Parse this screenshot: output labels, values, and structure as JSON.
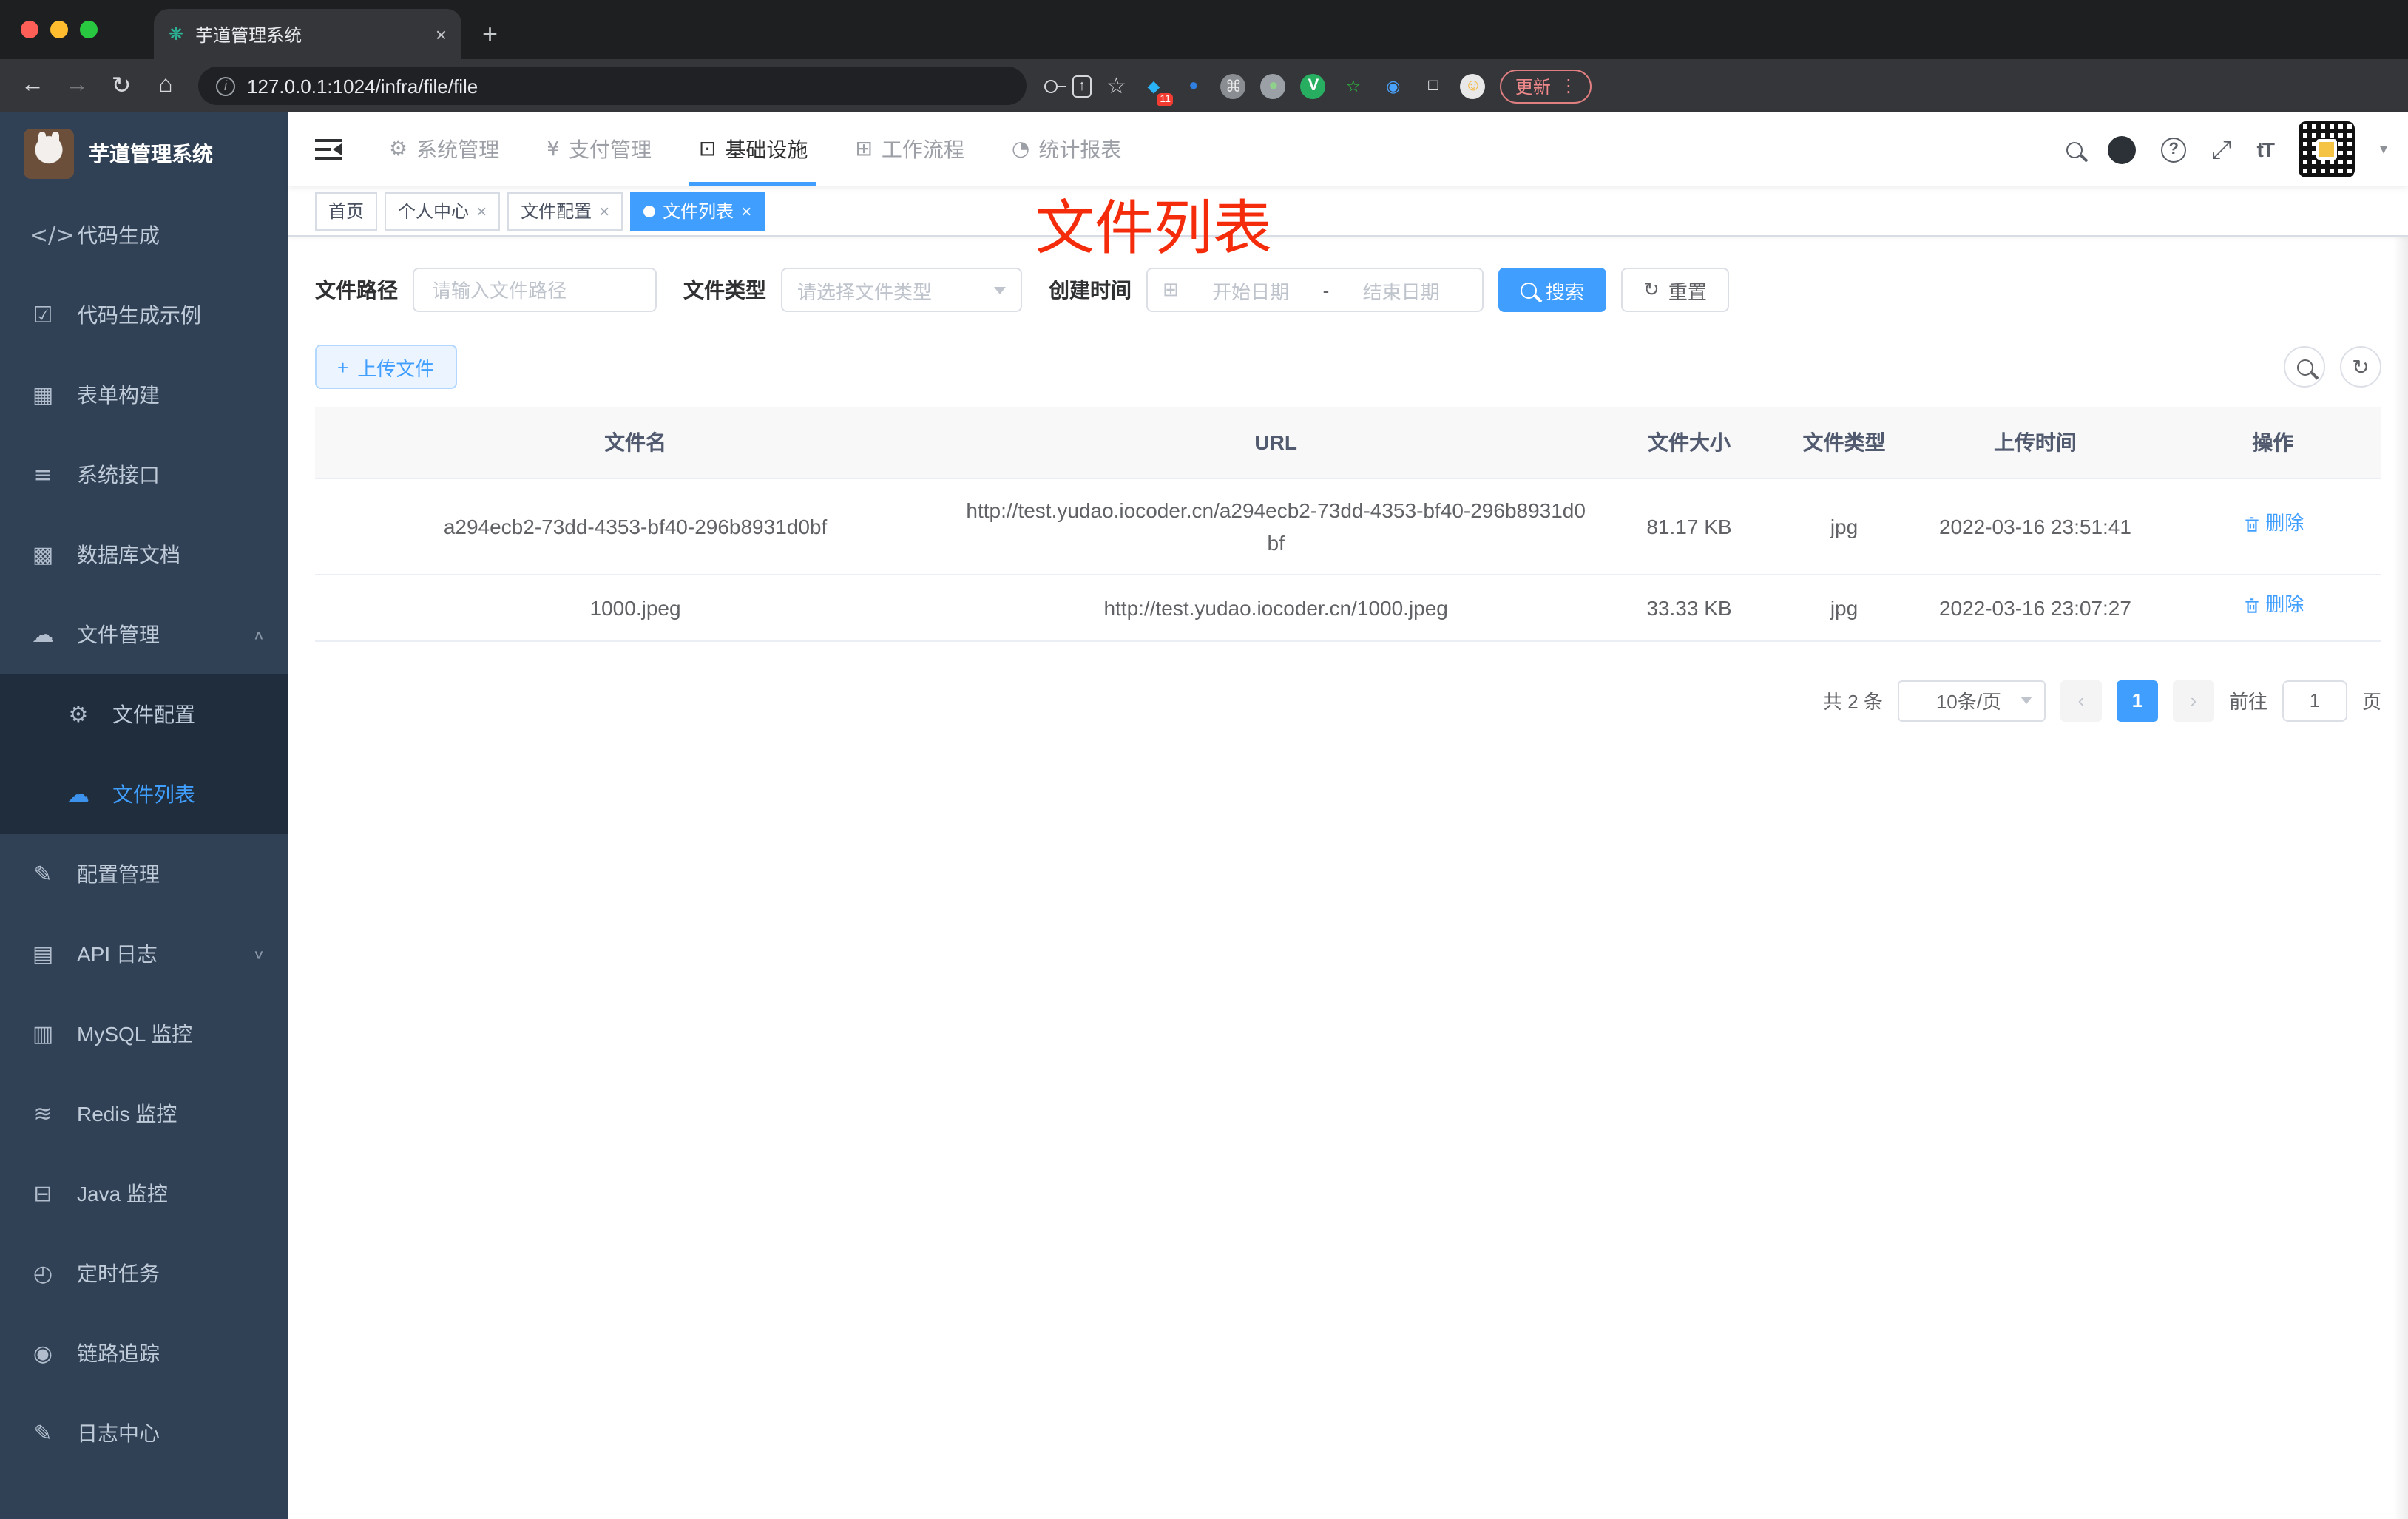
{
  "browser": {
    "tab_title": "芋道管理系统",
    "url": "127.0.0.1:1024/infra/file/file",
    "update_label": "更新",
    "extensions": [
      {
        "name": "blue-diamond",
        "glyph": "◆",
        "fg": "#2ab3f7",
        "bg": "transparent",
        "badge": "11"
      },
      {
        "name": "balloon",
        "glyph": "●",
        "fg": "#2f7fe0",
        "bg": "transparent",
        "badge": ""
      },
      {
        "name": "command",
        "glyph": "⌘",
        "fg": "#e8e8e8",
        "bg": "#8a8d91",
        "badge": ""
      },
      {
        "name": "green-dot",
        "glyph": "●",
        "fg": "#8fd08b",
        "bg": "#9aa0a6",
        "badge": ""
      },
      {
        "name": "v-circle",
        "glyph": "V",
        "fg": "#ffffff",
        "bg": "#27ae60",
        "badge": ""
      },
      {
        "name": "green-star",
        "glyph": "☆",
        "fg": "#2ecc40",
        "bg": "transparent",
        "badge": ""
      },
      {
        "name": "blue-eye",
        "glyph": "◉",
        "fg": "#4aa3ff",
        "bg": "transparent",
        "badge": ""
      },
      {
        "name": "puzzle",
        "glyph": "□",
        "fg": "#f1f1f1",
        "bg": "transparent",
        "badge": ""
      },
      {
        "name": "smiley",
        "glyph": "☺",
        "fg": "#f6b73c",
        "bg": "#e8e8e8",
        "badge": ""
      }
    ]
  },
  "glyphs": {
    "back": "←",
    "forward": "→",
    "reload": "↻",
    "home": "⌂",
    "info": "i",
    "share": "↑",
    "star": "☆",
    "dots": "⋮",
    "plus": "+",
    "close": "×",
    "caret_up": "∧",
    "caret_down": "∨",
    "chevron_left": "‹",
    "chevron_right": "›",
    "refresh": "↻",
    "calendar": "⊞",
    "date_sep": "-",
    "fullscreen": "⤢",
    "font_size": "tT"
  },
  "sidebar": {
    "title": "芋道管理系统",
    "items": [
      {
        "icon": "code-icon",
        "glyph": "</>",
        "label": "代码生成"
      },
      {
        "icon": "shield-check-icon",
        "glyph": "☑",
        "label": "代码生成示例"
      },
      {
        "icon": "form-icon",
        "glyph": "▦",
        "label": "表单构建"
      },
      {
        "icon": "sliders-icon",
        "glyph": "≡",
        "label": "系统接口"
      },
      {
        "icon": "database-table-icon",
        "glyph": "▩",
        "label": "数据库文档"
      },
      {
        "icon": "cloud-download-icon",
        "glyph": "☁",
        "label": "文件管理",
        "caret": "∧"
      },
      {
        "icon": "gear-icon",
        "glyph": "⚙",
        "label": "文件配置"
      },
      {
        "icon": "cloud-upload-icon",
        "glyph": "☁",
        "label": "文件列表"
      },
      {
        "icon": "edit-icon",
        "glyph": "✎",
        "label": "配置管理"
      },
      {
        "icon": "api-log-icon",
        "glyph": "▤",
        "label": "API 日志",
        "caret": "∨"
      },
      {
        "icon": "mysql-monitor-icon",
        "glyph": "▥",
        "label": "MySQL 监控"
      },
      {
        "icon": "redis-layers-icon",
        "glyph": "≋",
        "label": "Redis 监控"
      },
      {
        "icon": "java-monitor-icon",
        "glyph": "⊟",
        "label": "Java 监控"
      },
      {
        "icon": "timer-icon",
        "glyph": "◴",
        "label": "定时任务"
      },
      {
        "icon": "eye-icon",
        "glyph": "◉",
        "label": "链路追踪"
      },
      {
        "icon": "log-center-icon",
        "glyph": "✎",
        "label": "日志中心"
      }
    ]
  },
  "topnav": {
    "items": [
      {
        "icon": "gear-icon",
        "glyph": "⚙",
        "label": "系统管理"
      },
      {
        "icon": "yen-icon",
        "glyph": "¥",
        "label": "支付管理"
      },
      {
        "icon": "monitor-icon",
        "glyph": "⊡",
        "label": "基础设施"
      },
      {
        "icon": "briefcase-icon",
        "glyph": "⊞",
        "label": "工作流程"
      },
      {
        "icon": "dashboard-icon",
        "glyph": "◔",
        "label": "统计报表"
      }
    ]
  },
  "tags": {
    "items": [
      {
        "label": "首页"
      },
      {
        "label": "个人中心"
      },
      {
        "label": "文件配置"
      },
      {
        "label": "文件列表"
      }
    ]
  },
  "annotation": {
    "text": "文件列表",
    "color": "#f42c0c"
  },
  "filters": {
    "path_label": "文件路径",
    "path_placeholder": "请输入文件路径",
    "type_label": "文件类型",
    "type_placeholder": "请选择文件类型",
    "date_label": "创建时间",
    "date_start": "开始日期",
    "date_end": "结束日期",
    "search_label": "搜索",
    "reset_label": "重置"
  },
  "toolbar": {
    "upload_label": "上传文件"
  },
  "table": {
    "columns": [
      "文件名",
      "URL",
      "文件大小",
      "文件类型",
      "上传时间",
      "操作"
    ],
    "rows": [
      {
        "name": "a294ecb2-73dd-4353-bf40-296b8931d0bf",
        "url": "http://test.yudao.iocoder.cn/a294ecb2-73dd-4353-bf40-296b8931d0bf",
        "size": "81.17 KB",
        "type": "jpg",
        "time": "2022-03-16 23:51:41",
        "action": "删除"
      },
      {
        "name": "1000.jpeg",
        "url": "http://test.yudao.iocoder.cn/1000.jpeg",
        "size": "33.33 KB",
        "type": "jpg",
        "time": "2022-03-16 23:07:27",
        "action": "删除"
      }
    ]
  },
  "pagination": {
    "total": "共 2 条",
    "page_size": "10条/页",
    "current": "1",
    "goto_label": "前往",
    "goto_value": "1",
    "page_label": "页"
  },
  "colors": {
    "primary": "#409eff",
    "sidebar_bg": "#304156",
    "submenu_bg": "#1f2d3d",
    "annotation": "#f42c0c"
  }
}
